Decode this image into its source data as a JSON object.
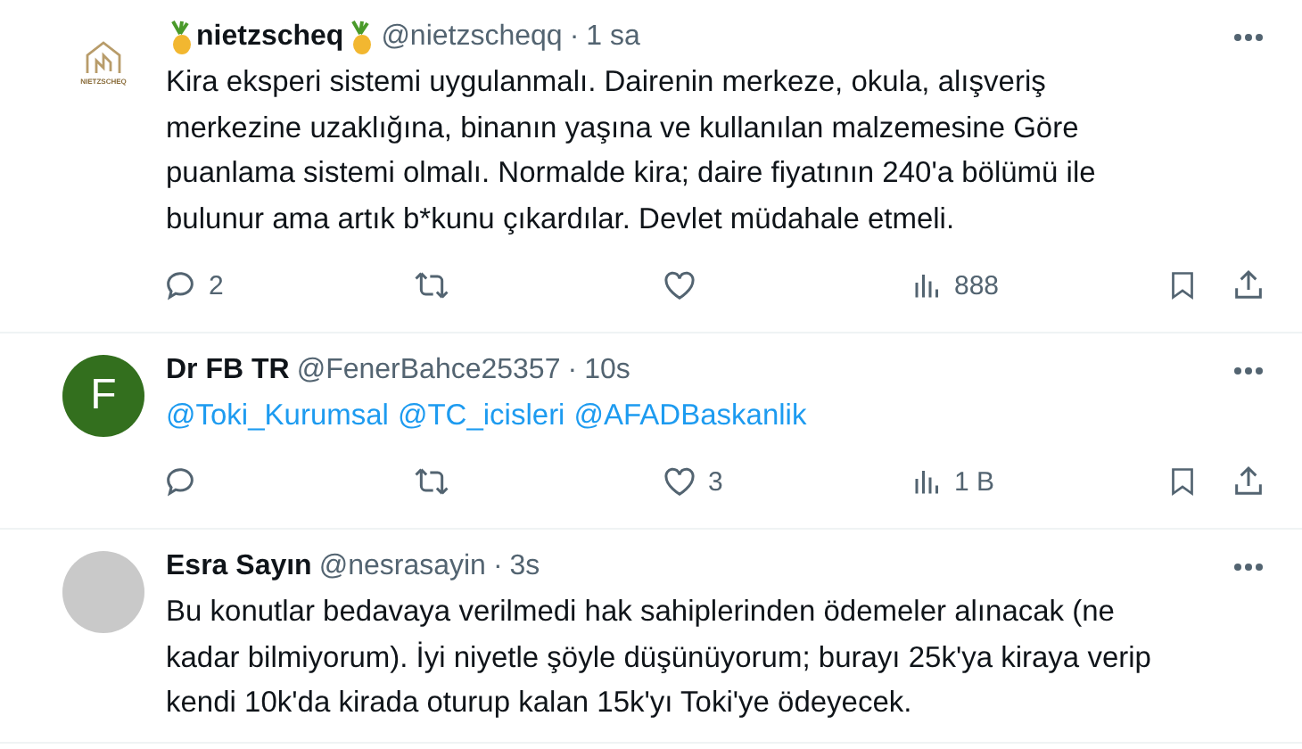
{
  "tweets": [
    {
      "avatar": {
        "kind": "logo",
        "text": "NIETZSCHEQ"
      },
      "name": "nietzscheq",
      "pineapples": true,
      "handle": "@nietzscheqq",
      "separator": "·",
      "time": "1 sa",
      "text": "Kira eksperi sistemi uygulanmalı. Dairenin merkeze, okula, alışveriş merkezine uzaklığına, binanın yaşına ve kullanılan malzemesine Göre puanlama sistemi olmalı. Normalde kira; daire fiyatının 240'a bölümü ile bulunur ama artık b*kunu çıkardılar. Devlet müdahale etmeli.",
      "replies": "2",
      "views": "888",
      "actions_visible": true
    },
    {
      "avatar": {
        "kind": "letter",
        "text": "F",
        "color": "#336f1e"
      },
      "name": "Dr FB TR",
      "handle": "@FenerBahce25357",
      "separator": "·",
      "time": "10s",
      "mentions": [
        "@Toki_Kurumsal",
        "@TC_icisleri",
        "@AFADBaskanlik"
      ],
      "likes": "3",
      "views": "1 B",
      "actions_visible": true
    },
    {
      "avatar": {
        "kind": "photo"
      },
      "name": "Esra Sayın",
      "handle": "@nesrasayin",
      "separator": "·",
      "time": "3s",
      "text": "Bu konutlar bedavaya verilmedi hak sahiplerinden ödemeler alınacak (ne kadar bilmiyorum). İyi niyetle şöyle düşünüyorum; burayı 25k'ya kiraya verip kendi 10k'da kirada oturup kalan 15k'yı Toki'ye ödeyecek."
    }
  ]
}
